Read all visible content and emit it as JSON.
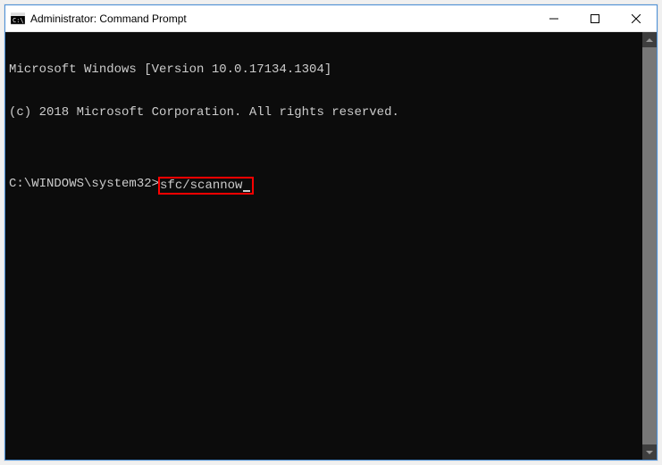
{
  "window": {
    "title": "Administrator: Command Prompt"
  },
  "terminal": {
    "line1": "Microsoft Windows [Version 10.0.17134.1304]",
    "line2": "(c) 2018 Microsoft Corporation. All rights reserved.",
    "blank": "",
    "prompt": "C:\\WINDOWS\\system32>",
    "command": "sfc/scannow"
  }
}
